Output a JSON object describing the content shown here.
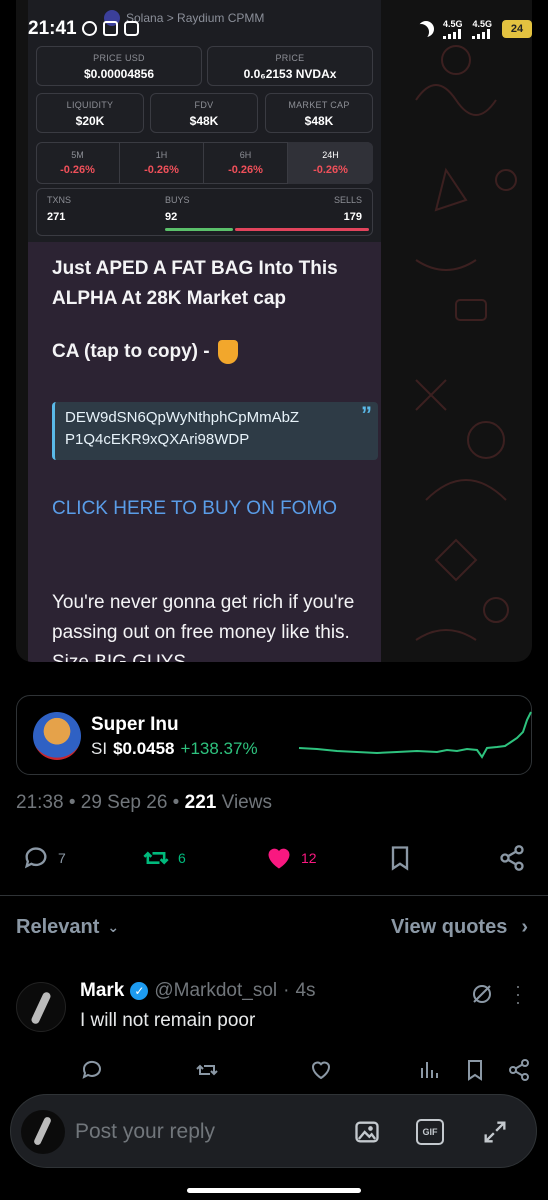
{
  "status_bar": {
    "time": "21:41",
    "network_1": "4.5G",
    "network_2": "4.5G",
    "battery": "24"
  },
  "media": {
    "app_header": "Solana > Raydium CPMM",
    "stats": {
      "price_usd_label": "PRICE USD",
      "price_usd": "$0.00004856",
      "price_label": "PRICE",
      "price": "0.0₆2153 NVDAx",
      "liquidity_label": "LIQUIDITY",
      "liquidity": "$20K",
      "fdv_label": "FDV",
      "fdv": "$48K",
      "mcap_label": "MARKET CAP",
      "mcap": "$48K"
    },
    "timeframes": [
      {
        "label": "5M",
        "value": "-0.26%"
      },
      {
        "label": "1H",
        "value": "-0.26%"
      },
      {
        "label": "6H",
        "value": "-0.26%"
      },
      {
        "label": "24H",
        "value": "-0.26%"
      }
    ],
    "txns": {
      "txns_label": "TXNS",
      "txns": "271",
      "buys_label": "BUYS",
      "buys": "92",
      "sells_label": "SELLS",
      "sells": "179"
    },
    "message": {
      "title": "Just APED A FAT BAG Into This ALPHA At 28K Market cap",
      "ca_label": "CA (tap to copy) -",
      "ca_line1": "DEW9dSN6QpWyNthphCpMmAbZ",
      "ca_line2": "P1Q4cEKR9xQXAri98WDP",
      "link": "CLICK HERE TO BUY ON FOMO",
      "body": "You're never gonna get rich if you're passing out on free money like this. Size BIG GUYS"
    }
  },
  "ticker": {
    "name": "Super Inu",
    "symbol": "SI",
    "price": "$0.0458",
    "change": "+138.37%",
    "sparkline_color": "#2ec27e"
  },
  "post_meta": {
    "time": "21:38",
    "date": "29 Sep 26",
    "views_count": "221",
    "views_label": "Views"
  },
  "actions": {
    "replies": "7",
    "reposts": "6",
    "likes": "12",
    "like_color": "#f91880",
    "repost_color": "#00ba7c"
  },
  "replies_header": {
    "sort_label": "Relevant",
    "view_quotes": "View quotes"
  },
  "reply": {
    "name": "Mark",
    "handle": "@Markdot_sol",
    "time": "4s",
    "text": "I will not remain poor"
  },
  "composer": {
    "placeholder": "Post your reply",
    "gif_label": "GIF"
  }
}
